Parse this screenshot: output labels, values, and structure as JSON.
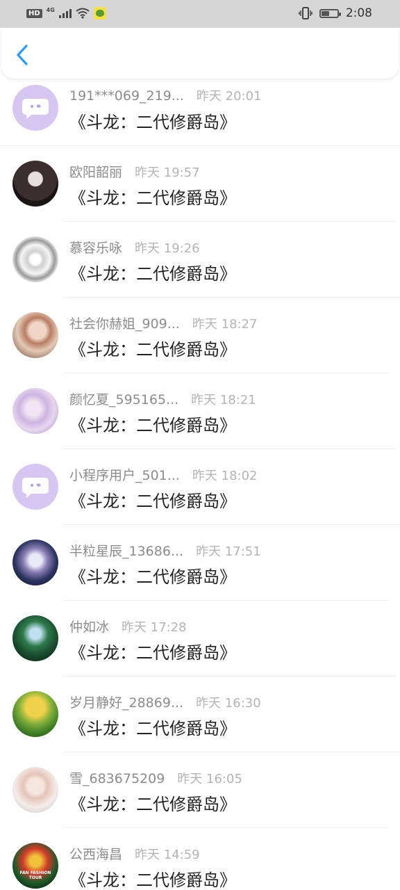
{
  "status_bar": {
    "hd_label": "HD",
    "network_label": "4G",
    "time": "2:08",
    "battery_level": 0.45,
    "icons": [
      "hd-icon",
      "signal-icon",
      "wifi-icon",
      "wechat-icon",
      "vibrate-icon",
      "battery-icon"
    ]
  },
  "nav": {
    "back_icon": "chevron-left-icon",
    "accent_color": "#2e9bf0"
  },
  "messages": [
    {
      "name": "191***069_219...",
      "time": "昨天 20:01",
      "title": "《斗龙：二代修爵岛》",
      "avatar": "chat-bubble-icon"
    },
    {
      "name": "欧阳韶丽",
      "time": "昨天 19:57",
      "title": "《斗龙：二代修爵岛》",
      "avatar": "photo"
    },
    {
      "name": "慕容乐咏",
      "time": "昨天 19:26",
      "title": "《斗龙：二代修爵岛》",
      "avatar": "photo"
    },
    {
      "name": "社会你赫姐_909...",
      "time": "昨天 18:27",
      "title": "《斗龙：二代修爵岛》",
      "avatar": "photo"
    },
    {
      "name": "颜忆夏_595165...",
      "time": "昨天 18:21",
      "title": "《斗龙：二代修爵岛》",
      "avatar": "photo"
    },
    {
      "name": "小程序用户_501...",
      "time": "昨天 18:02",
      "title": "《斗龙：二代修爵岛》",
      "avatar": "chat-bubble-icon"
    },
    {
      "name": "半粒星辰_13686...",
      "time": "昨天 17:51",
      "title": "《斗龙：二代修爵岛》",
      "avatar": "photo"
    },
    {
      "name": "仲如冰",
      "time": "昨天 17:28",
      "title": "《斗龙：二代修爵岛》",
      "avatar": "photo"
    },
    {
      "name": "岁月静好_28869...",
      "time": "昨天 16:30",
      "title": "《斗龙：二代修爵岛》",
      "avatar": "photo"
    },
    {
      "name": "雪_683675209",
      "time": "昨天 16:05",
      "title": "《斗龙：二代修爵岛》",
      "avatar": "photo"
    },
    {
      "name": "公西海昌",
      "time": "昨天 14:59",
      "title": "《斗龙：二代修爵岛》",
      "avatar": "photo",
      "avatar_caption": "FAN FASHION TOUR"
    }
  ]
}
